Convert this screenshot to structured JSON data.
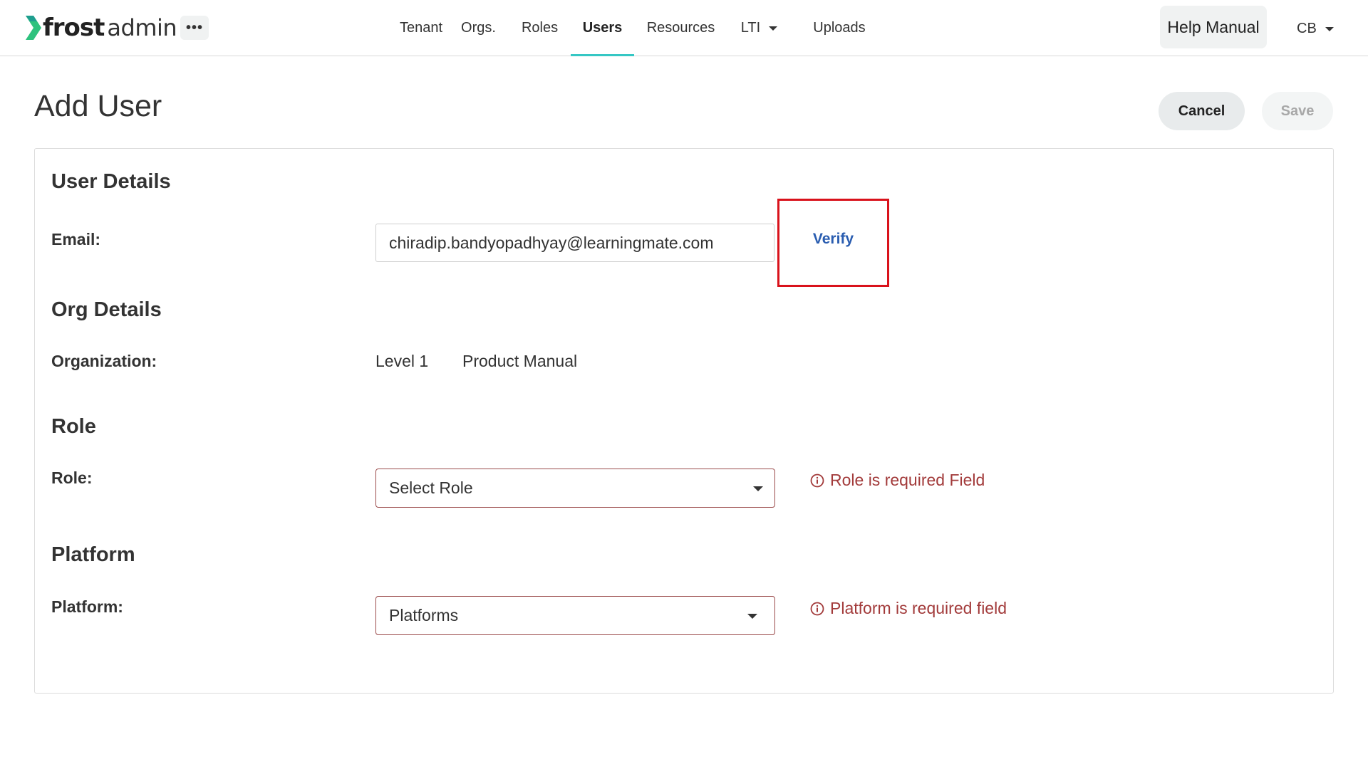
{
  "app": {
    "logo_frost": "frost",
    "logo_admin": "admin",
    "more_label": "•••",
    "nav": [
      {
        "label": "Tenant",
        "active": false
      },
      {
        "label": "Orgs.",
        "active": false
      },
      {
        "label": "Roles",
        "active": false
      },
      {
        "label": "Users",
        "active": true
      },
      {
        "label": "Resources",
        "active": false
      },
      {
        "label": "LTI",
        "active": false,
        "has_dropdown": true
      },
      {
        "label": "Uploads",
        "active": false
      }
    ],
    "help_label": "Help Manual",
    "user_initials": "CB"
  },
  "page": {
    "title": "Add User",
    "cancel_label": "Cancel",
    "save_label": "Save"
  },
  "form": {
    "user_details": {
      "heading": "User Details",
      "email_label": "Email:",
      "email_value": "chiradip.bandyopadhyay@learningmate.com",
      "verify_label": "Verify"
    },
    "org_details": {
      "heading": "Org Details",
      "organization_label": "Organization:",
      "level": "Level 1",
      "org_name": "Product Manual"
    },
    "role": {
      "heading": "Role",
      "role_label": "Role:",
      "role_value": "Select Role",
      "error": "Role is required Field"
    },
    "platform": {
      "heading": "Platform",
      "platform_label": "Platform:",
      "platform_value": "Platforms",
      "error": "Platform is required field"
    }
  },
  "colors": {
    "accent": "#35c7c4",
    "error": "#a23a3a",
    "link": "#2a5db0",
    "highlight_box": "#d9121b"
  }
}
